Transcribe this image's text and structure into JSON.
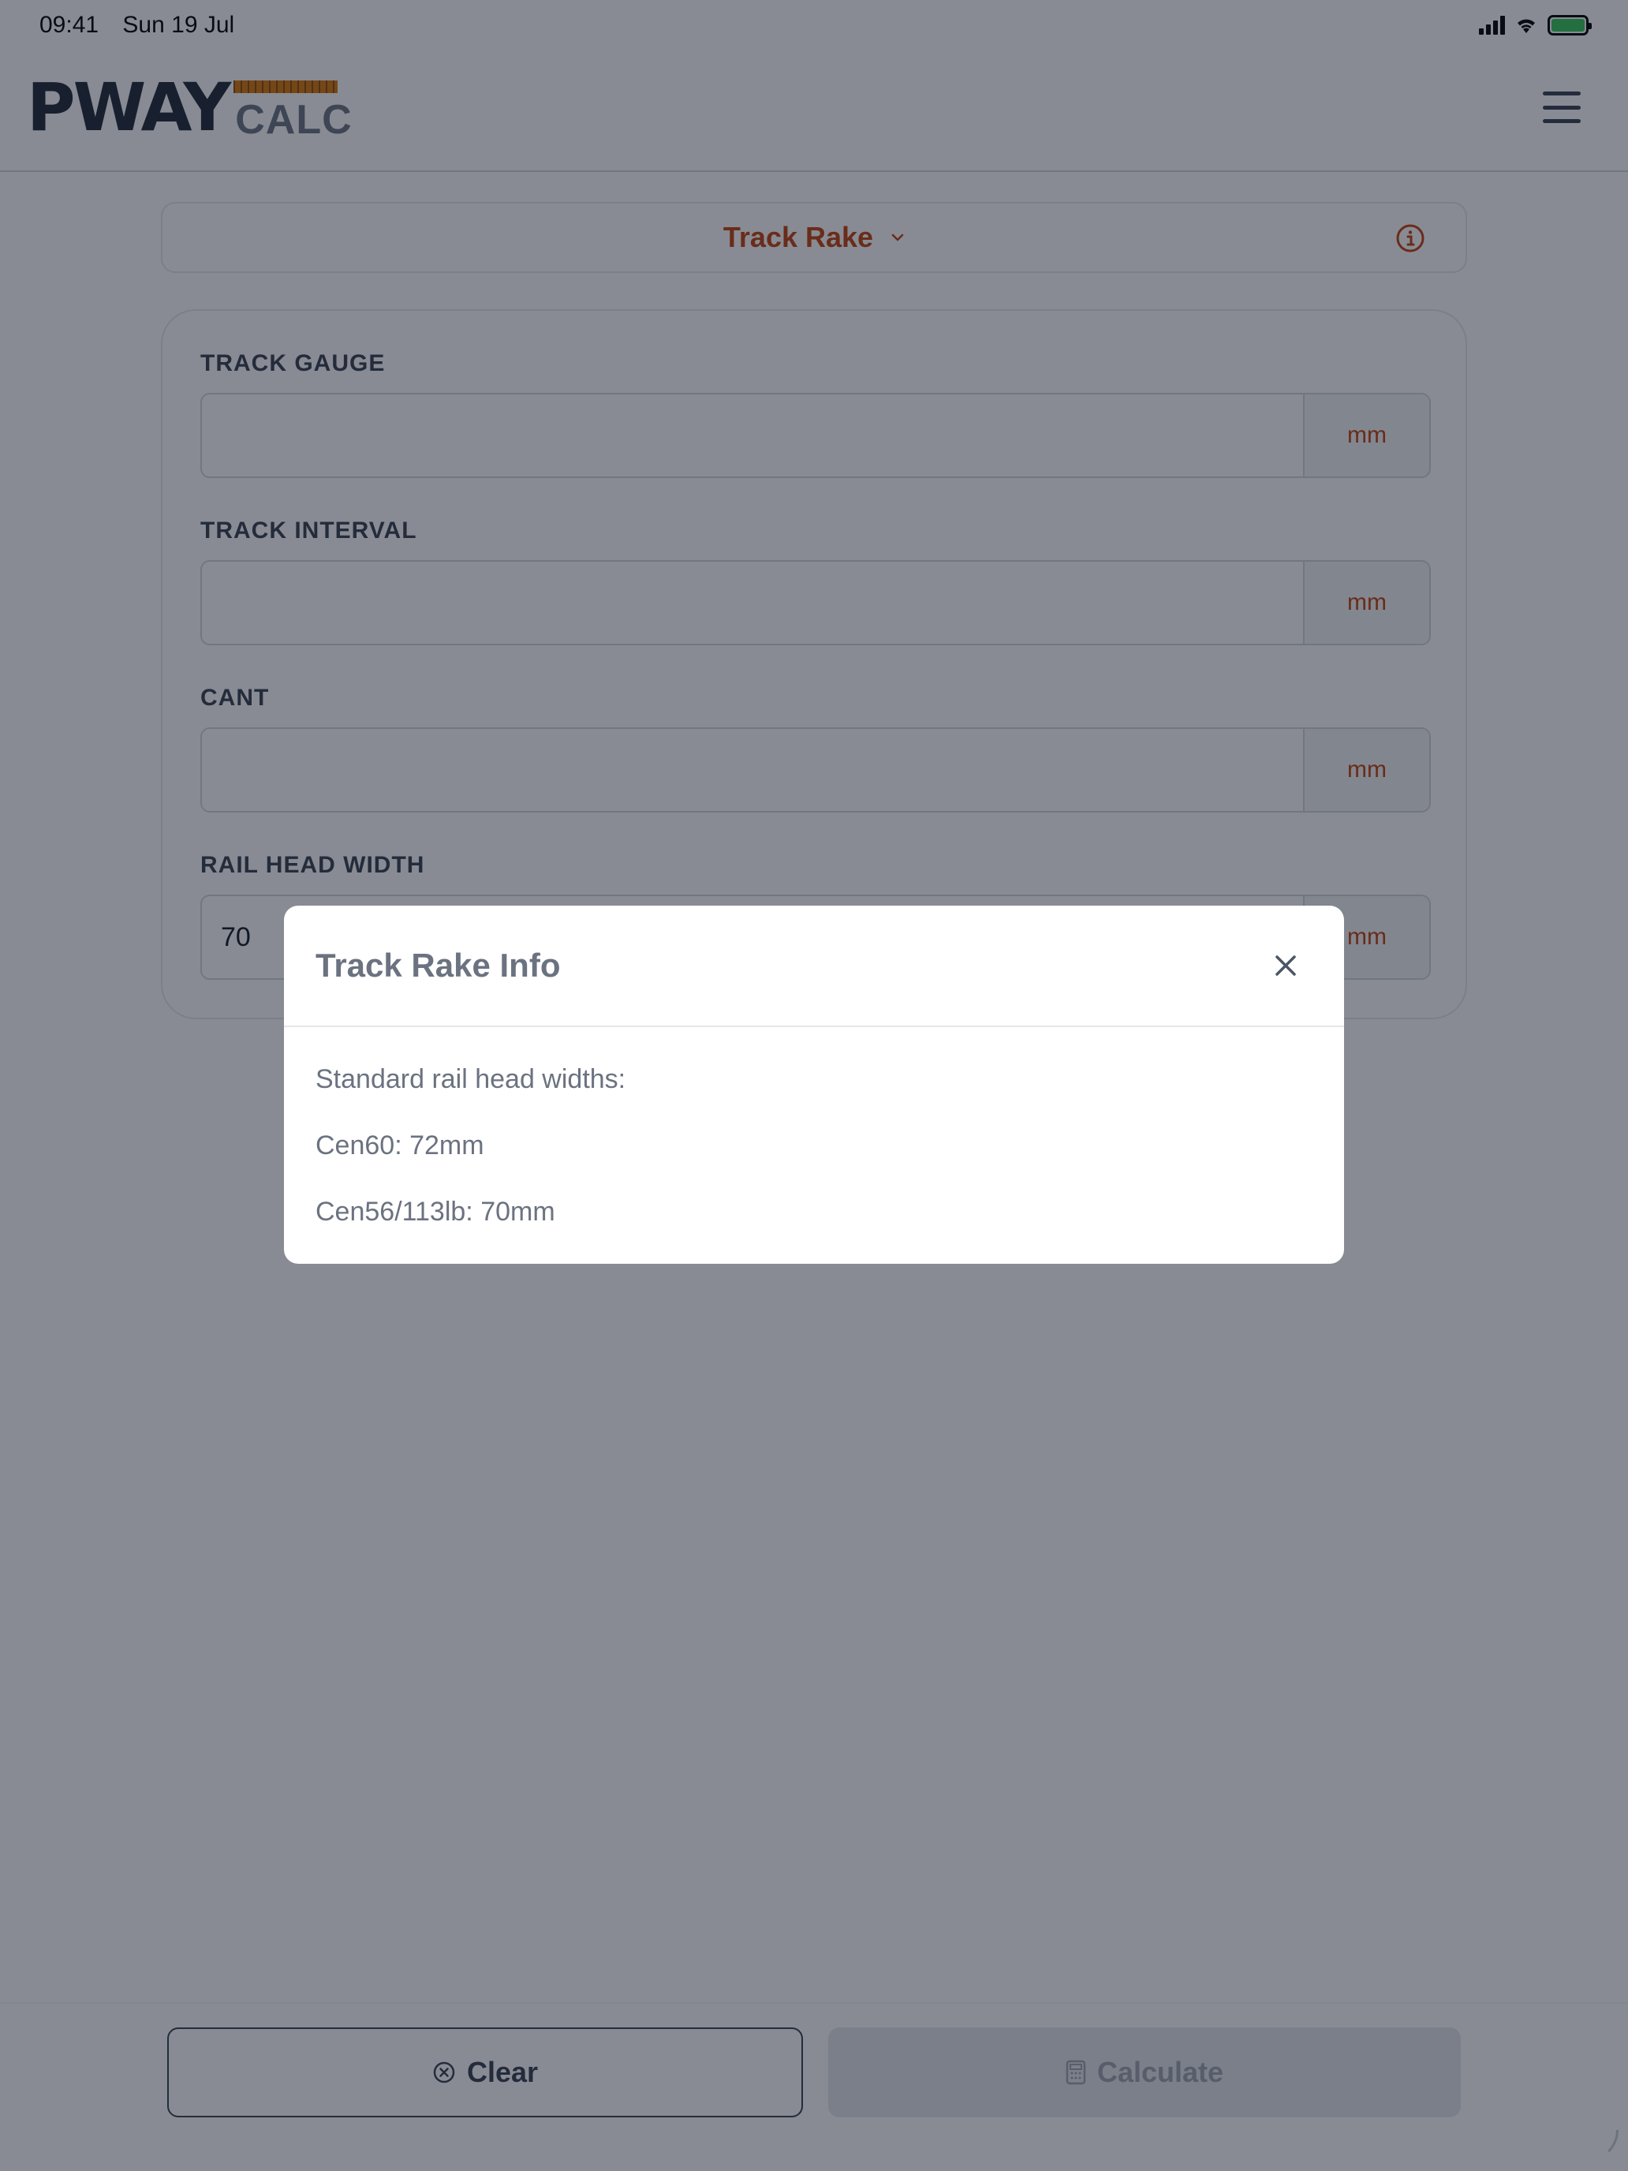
{
  "status_bar": {
    "time": "09:41",
    "date": "Sun 19 Jul"
  },
  "logo": {
    "primary": "PWAY",
    "secondary": "CALC"
  },
  "selector": {
    "title": "Track Rake"
  },
  "fields": [
    {
      "label": "TRACK GAUGE",
      "value": "",
      "unit": "mm"
    },
    {
      "label": "TRACK INTERVAL",
      "value": "",
      "unit": "mm"
    },
    {
      "label": "CANT",
      "value": "",
      "unit": "mm"
    },
    {
      "label": "RAIL HEAD WIDTH",
      "value": "70",
      "unit": "mm"
    }
  ],
  "buttons": {
    "clear": "Clear",
    "calculate": "Calculate"
  },
  "modal": {
    "title": "Track Rake Info",
    "lines": [
      "Standard rail head widths:",
      "Cen60: 72mm",
      "Cen56/113lb: 70mm"
    ]
  },
  "colors": {
    "accent": "#c2410c",
    "logo_ruler": "#d97706",
    "battery": "#34c759"
  }
}
